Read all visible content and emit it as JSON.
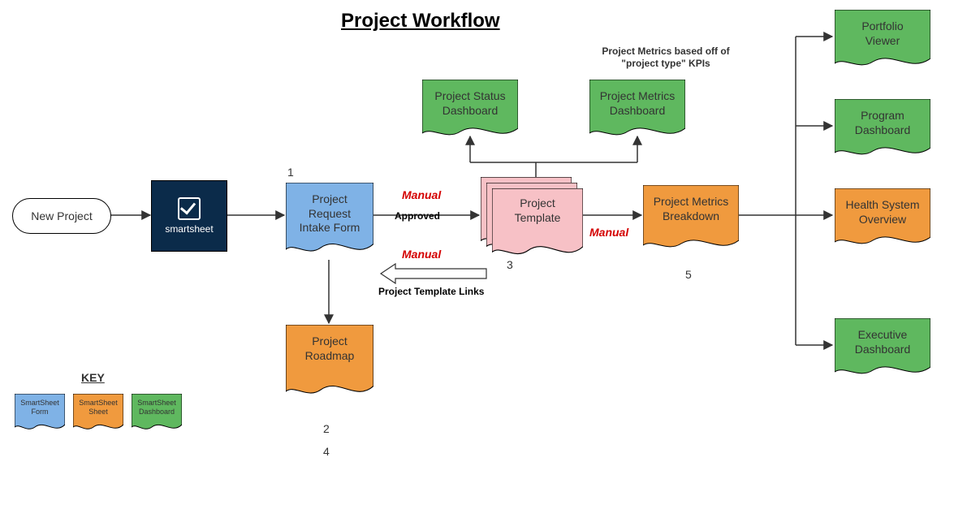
{
  "title": "Project Workflow",
  "nodes": {
    "new_project": "New Project",
    "smartsheet": "smartsheet",
    "intake": "Project\nRequest\nIntake Form",
    "roadmap": "Project\nRoadmap",
    "template": "Project\nTemplate",
    "status_dash": "Project Status\nDashboard",
    "metrics_dash": "Project Metrics\nDashboard",
    "metrics_breakdown": "Project Metrics\nBreakdown",
    "portfolio": "Portfolio\nViewer",
    "program": "Program\nDashboard",
    "health": "Health System\nOverview",
    "exec": "Executive\nDashboard"
  },
  "labels": {
    "approved": "Approved",
    "manual": "Manual",
    "template_links": "Project Template Links",
    "metrics_note": "Project Metrics based off of\n\"project type\" KPIs"
  },
  "sequence": {
    "s1": "1",
    "s2": "2",
    "s3": "3",
    "s4": "4",
    "s5": "5"
  },
  "key": {
    "title": "KEY",
    "form": "SmartSheet\nForm",
    "sheet": "SmartSheet\nSheet",
    "dashboard": "SmartSheet\nDashboard"
  },
  "colors": {
    "blue": "#7fb2e6",
    "orange": "#f09a3e",
    "green": "#5fb85f",
    "pink": "#f7c1c6",
    "navy": "#0b2b4a"
  }
}
